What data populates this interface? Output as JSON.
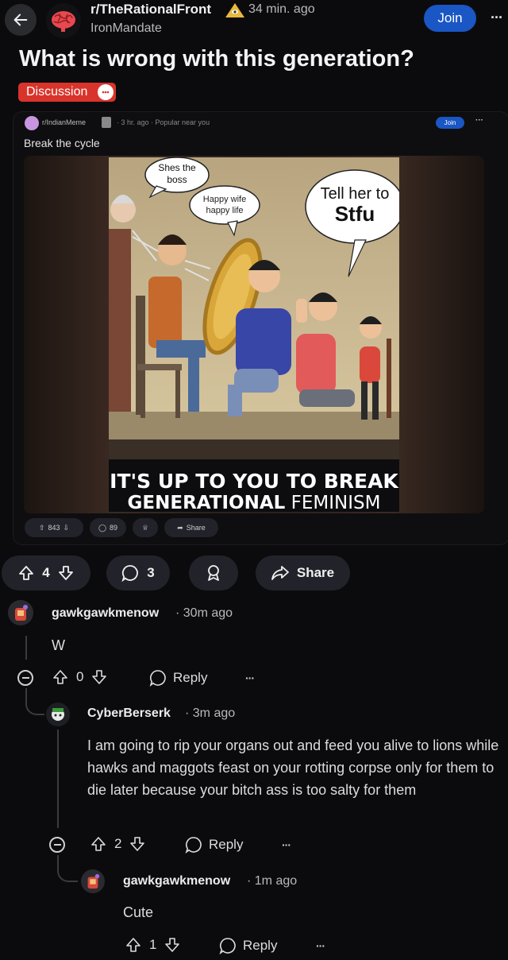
{
  "header": {
    "subreddit": "r/TheRationalFront",
    "time": "34 min. ago",
    "author": "IronMandate",
    "join_label": "Join",
    "more_label": "···"
  },
  "post": {
    "title": "What is wrong with this generation?",
    "flair": "Discussion"
  },
  "embedded": {
    "subreddit": "r/IndianMeme",
    "meta": "· 3 hr. ago · Popular near you",
    "join_label": "Join",
    "title": "Break the cycle",
    "meme": {
      "bubble1": "Shes the boss",
      "bubble2": "Happy wife happy life",
      "bubble3": "Tell her to Stfu",
      "caption_line1": "IT'S UP TO YOU TO BREAK",
      "caption_line2_bold": "GENERATIONAL",
      "caption_line2_rest": "FEMINISM"
    },
    "votes": "843",
    "comments": "89",
    "share_label": "Share"
  },
  "actions": {
    "votes": "4",
    "comments": "3",
    "share_label": "Share"
  },
  "comments": [
    {
      "user": "gawkgawkmenow",
      "time": "· 30m ago",
      "body": "W",
      "votes": "0",
      "reply_label": "Reply"
    },
    {
      "user": "CyberBerserk",
      "time": "· 3m ago",
      "body": "I am going to rip your organs out and feed you alive to lions while hawks and maggots feast on your rotting corpse only for them to die later because your bitch ass is too salty for them",
      "votes": "2",
      "reply_label": "Reply"
    },
    {
      "user": "gawkgawkmenow",
      "time": "· 1m ago",
      "body": "Cute",
      "votes": "1",
      "reply_label": "Reply"
    }
  ],
  "colors": {
    "background": "#0b0b0d",
    "join": "#1a56c4",
    "flair": "#d9342b",
    "pill": "#22232a"
  }
}
